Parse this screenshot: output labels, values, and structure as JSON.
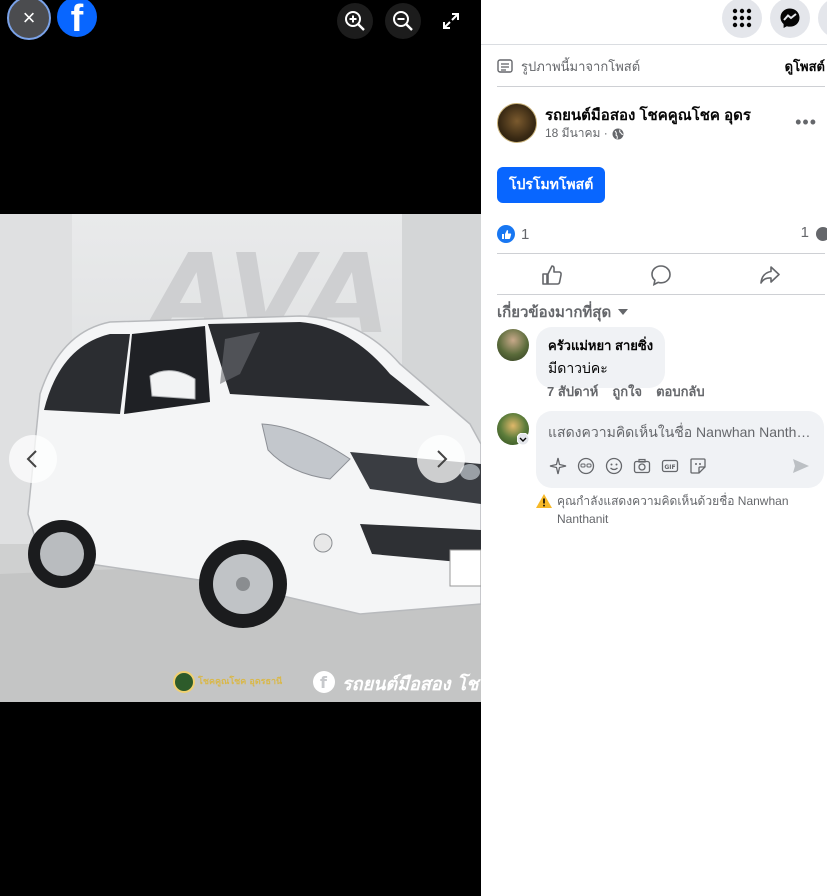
{
  "viewer": {
    "close_label": "×",
    "brand_letter": "f",
    "photo": {
      "watermark": "AVA",
      "banner_text": "รถยนต์มือสอง โช",
      "dealer_logo_text": "โชคคูณโชค อุดรธานี"
    }
  },
  "panel": {
    "from_post": "รูปภาพนี้มาจากโพสต์",
    "view_post": "ดูโพสต์",
    "page_name": "รถยนต์มือสอง โชคคูณโชค อุดร",
    "post_date": "18 มีนาคม ·",
    "more": "•••",
    "promote_label": "โปรโมทโพสต์",
    "reaction_count": "1",
    "comment_count": "1",
    "relevant_label": "เกี่ยวข้องมากที่สุด",
    "comment": {
      "author": "ครัวแม่หยา สายซิ่ง",
      "text": "มีดาวบ่คะ",
      "time": "7 สัปดาห์",
      "like": "ถูกใจ",
      "reply": "ตอบกลับ"
    },
    "composer": {
      "placeholder": "แสดงความคิดเห็นในชื่อ Nanwhan Nanthanit"
    },
    "warning": "คุณกำลังแสดงความคิดเห็นด้วยชื่อ Nanwhan Nanthanit"
  },
  "colors": {
    "brand": "#0866ff",
    "like": "#1877f2",
    "muted": "#65676b"
  }
}
